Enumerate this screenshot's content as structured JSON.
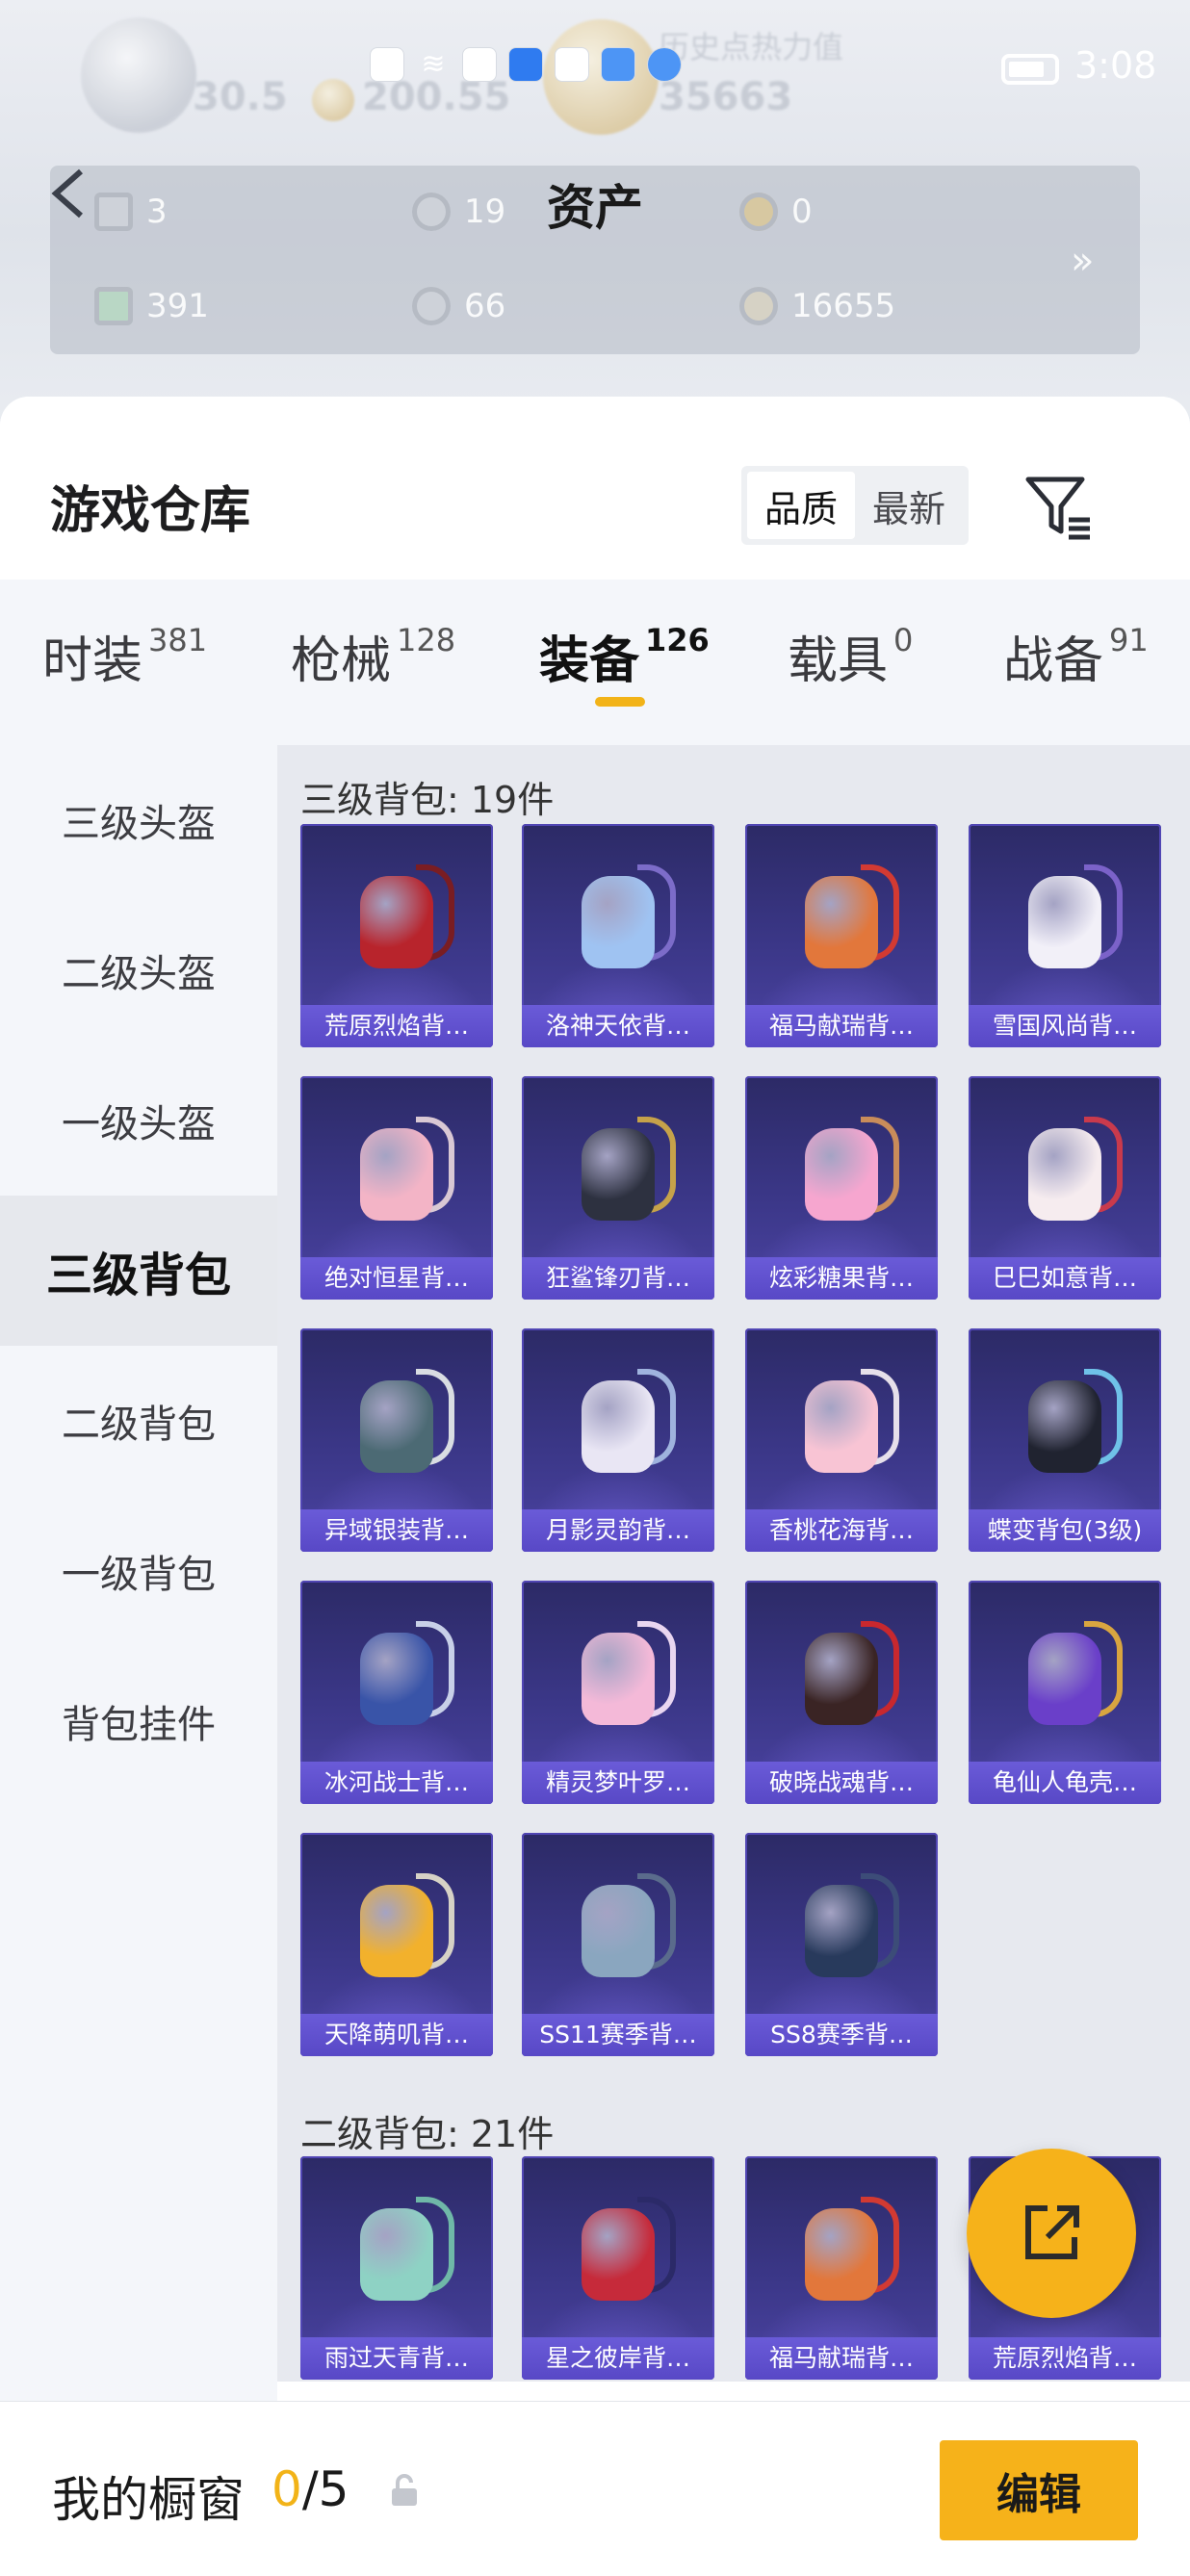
{
  "status_bar": {
    "time": "3:08"
  },
  "hero": {
    "ghost_texts": [
      "30.5",
      "200.55",
      "历史点热力值",
      "35663"
    ],
    "assets": [
      {
        "icon": "coupon-icon",
        "value": "3"
      },
      {
        "icon": "silver-coin-icon",
        "value": "19"
      },
      {
        "icon": "gold-coin-icon",
        "value": "0"
      },
      {
        "icon": "ticket-icon",
        "value": "391"
      },
      {
        "icon": "token-icon",
        "value": "66"
      },
      {
        "icon": "bp-coin-icon",
        "value": "16655"
      }
    ],
    "title": "资产",
    "more_arrow": "»"
  },
  "sheet": {
    "title": "游戏仓库",
    "sort": [
      "品质",
      "最新"
    ],
    "active_sort": "品质"
  },
  "tabs": [
    {
      "label": "时装",
      "count": "381"
    },
    {
      "label": "枪械",
      "count": "128"
    },
    {
      "label": "装备",
      "count": "126"
    },
    {
      "label": "载具",
      "count": "0"
    },
    {
      "label": "战备",
      "count": "91"
    }
  ],
  "active_tab": "装备",
  "sidebar": [
    "三级头盔",
    "二级头盔",
    "一级头盔",
    "三级背包",
    "二级背包",
    "一级背包",
    "背包挂件"
  ],
  "active_sidebar": "三级背包",
  "sections": [
    {
      "title": "三级背包: 19件",
      "items": [
        {
          "name": "荒原烈焰背…",
          "color": "#b8242c",
          "strap": "#7a1d22"
        },
        {
          "name": "洛神天依背…",
          "color": "#9fc3f2",
          "strap": "#7c6cc9"
        },
        {
          "name": "福马献瑞背…",
          "color": "#e2773b",
          "strap": "#d23a32"
        },
        {
          "name": "雪国风尚背…",
          "color": "#f2f0f8",
          "strap": "#7b62c9"
        },
        {
          "name": "绝对恒星背…",
          "color": "#f3b4c6",
          "strap": "#d9c8d4"
        },
        {
          "name": "狂鲨锋刃背…",
          "color": "#2d3140",
          "strap": "#c6a24a"
        },
        {
          "name": "炫彩糖果背…",
          "color": "#f6a6cf",
          "strap": "#c98c5a"
        },
        {
          "name": "巳巳如意背…",
          "color": "#f6ecef",
          "strap": "#c93a4c"
        },
        {
          "name": "异域银装背…",
          "color": "#4c6a74",
          "strap": "#d9dde2"
        },
        {
          "name": "月影灵韵背…",
          "color": "#e9e6f4",
          "strap": "#9fb3de"
        },
        {
          "name": "香桃花海背…",
          "color": "#f8c4d4",
          "strap": "#e6e0ea"
        },
        {
          "name": "蝶变背包(3级)",
          "color": "#202330",
          "strap": "#6fc1e8"
        },
        {
          "name": "冰河战士背…",
          "color": "#3954a8",
          "strap": "#c8d0e8"
        },
        {
          "name": "精灵梦叶罗…",
          "color": "#f4b9d8",
          "strap": "#e9d6f0"
        },
        {
          "name": "破晓战魂背…",
          "color": "#3a2424",
          "strap": "#c8282e"
        },
        {
          "name": "龟仙人龟壳…",
          "color": "#6a3fc9",
          "strap": "#d9a540"
        },
        {
          "name": "天降萌叽背…",
          "color": "#f2b12c",
          "strap": "#d6d2c6"
        },
        {
          "name": "SS11赛季背…",
          "color": "#8aa6bf",
          "strap": "#5a6b8c"
        },
        {
          "name": "SS8赛季背…",
          "color": "#283a5c",
          "strap": "#3c4c78"
        }
      ]
    },
    {
      "title": "二级背包: 21件",
      "items": [
        {
          "name": "雨过天青背…",
          "color": "#8ed2c4",
          "strap": "#6fb8a8"
        },
        {
          "name": "星之彼岸背…",
          "color": "#c62a3a",
          "strap": "#2b2a68"
        },
        {
          "name": "福马献瑞背…",
          "color": "#e2773b",
          "strap": "#d23a32"
        },
        {
          "name": "荒原烈焰背…",
          "color": "#b8242c",
          "strap": "#7a1d22"
        }
      ]
    }
  ],
  "bottom_bar": {
    "label": "我的橱窗",
    "count": "0",
    "total": "/5",
    "edit": "编辑"
  },
  "colors": {
    "accent": "#f6b21a",
    "card": "#3b3788",
    "card_label": "#5848c6"
  }
}
